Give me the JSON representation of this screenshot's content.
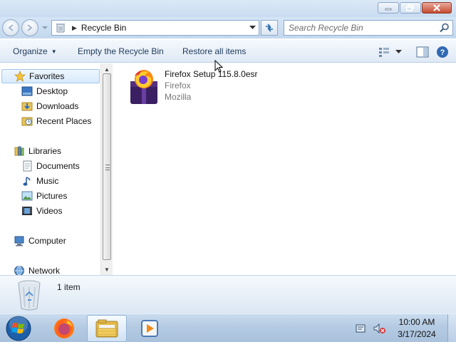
{
  "window": {
    "title_buttons": [
      "minimize-icon",
      "maximize-icon",
      "close-icon"
    ]
  },
  "address": {
    "path": "Recycle Bin",
    "search_placeholder": "Search Recycle Bin"
  },
  "toolbar": {
    "organize_label": "Organize",
    "empty_label": "Empty the Recycle Bin",
    "restore_label": "Restore all items"
  },
  "nav": {
    "favorites": "Favorites",
    "desktop": "Desktop",
    "downloads": "Downloads",
    "recent_places": "Recent Places",
    "libraries": "Libraries",
    "documents": "Documents",
    "music": "Music",
    "pictures": "Pictures",
    "videos": "Videos",
    "computer": "Computer",
    "network": "Network"
  },
  "files": [
    {
      "name": "Firefox Setup 115.8.0esr",
      "line2": "Firefox",
      "line3": "Mozilla"
    }
  ],
  "details": {
    "count": "1 item"
  },
  "taskbar": {
    "time": "10:00 AM",
    "date": "3/17/2024"
  },
  "colors": {
    "toolbar_text": "#1e395b",
    "chrome_blue": "#c9dcf1",
    "close_red": "#c54a31"
  }
}
